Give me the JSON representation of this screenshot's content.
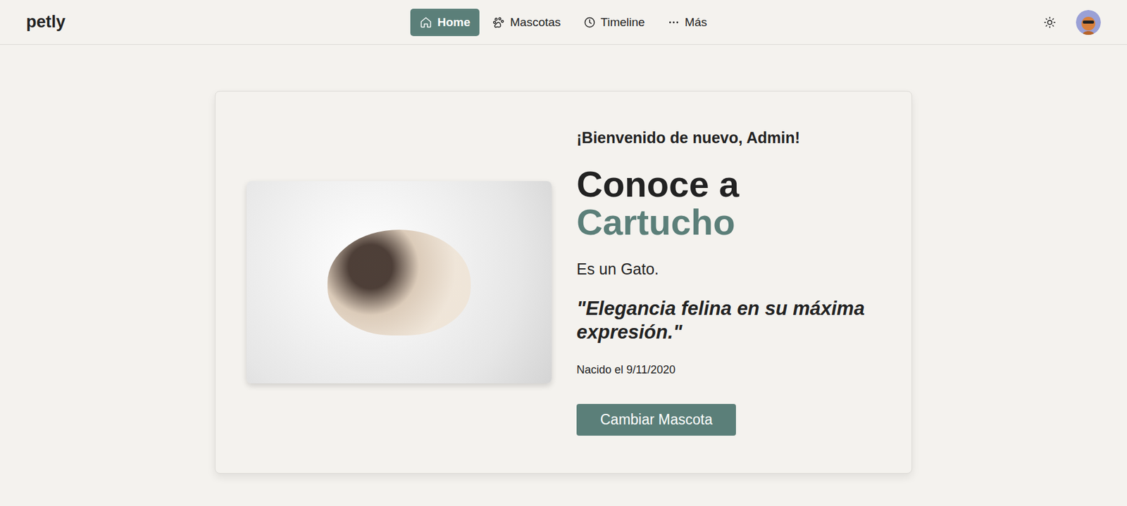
{
  "header": {
    "logo": "petly",
    "nav": [
      {
        "label": "Home",
        "icon": "home",
        "selected": true
      },
      {
        "label": "Mascotas",
        "icon": "paw",
        "selected": false
      },
      {
        "label": "Timeline",
        "icon": "clock",
        "selected": false
      },
      {
        "label": "Más",
        "icon": "dots",
        "selected": false
      }
    ]
  },
  "hero": {
    "welcome": "¡Bienvenido de nuevo, Admin!",
    "title_prefix": "Conoce a",
    "pet_name": "Cartucho",
    "species_prefix": "Es un",
    "species": "Gato.",
    "quote": "\"Elegancia felina en su máxima expresión.\"",
    "birth": "Nacido el 9/11/2020",
    "button": "Cambiar Mascota"
  }
}
